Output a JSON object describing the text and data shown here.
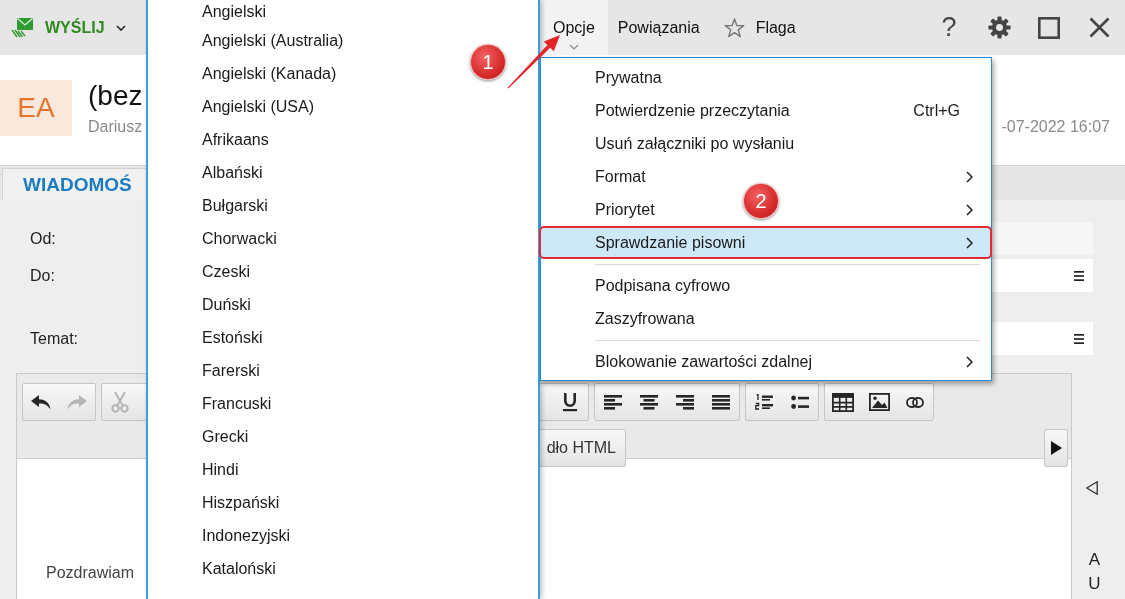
{
  "top_bar": {
    "send_button": {
      "label": "WYŚLIJ"
    },
    "tabs": [
      {
        "label": "Opcje",
        "kind": "menu",
        "expanded": true
      },
      {
        "label": "Powiązania",
        "kind": "menu",
        "expanded": false
      },
      {
        "label": "Flaga",
        "kind": "toggle",
        "expanded": false
      }
    ],
    "help_button": {
      "label": "?"
    }
  },
  "message": {
    "avatar_initials": "EA",
    "subject": "(bez",
    "sender": "Dariusz",
    "date": "-07-2022 16:07"
  },
  "message_tabs": [
    {
      "label": "WIADOMOŚ",
      "selected": true
    }
  ],
  "fields": [
    {
      "label": "Od:",
      "kind": "plain"
    },
    {
      "label": "Do:",
      "kind": "with_menu"
    },
    {
      "label": "Temat:",
      "kind": "with_menu"
    }
  ],
  "editor": {
    "toolbar": {
      "groups": [
        {
          "buttons": [
            {
              "kind": "undo",
              "disabled": false
            },
            {
              "kind": "redo",
              "disabled": true
            }
          ]
        },
        {
          "buttons": [
            {
              "kind": "cut",
              "disabled": true
            },
            {
              "kind": "underline",
              "disabled": false
            }
          ]
        },
        {
          "buttons": [
            {
              "kind": "align_left",
              "disabled": false
            },
            {
              "kind": "align_center",
              "disabled": false
            },
            {
              "kind": "align_right",
              "disabled": false
            },
            {
              "kind": "justify",
              "disabled": false
            }
          ]
        },
        {
          "buttons": [
            {
              "kind": "numbered_list",
              "disabled": false
            },
            {
              "kind": "bullet_list",
              "disabled": false
            }
          ]
        },
        {
          "buttons": [
            {
              "kind": "table",
              "disabled": false
            },
            {
              "kind": "image",
              "disabled": false
            },
            {
              "kind": "link",
              "disabled": false
            }
          ]
        }
      ]
    },
    "source_button": {
      "label": "dło HTML"
    },
    "body_lines": [
      "Pozdrawiam"
    ]
  },
  "side_panel": {
    "label": "AU"
  },
  "language_submenu": {
    "items": [
      {
        "label": "Angielski",
        "selected": false
      },
      {
        "label": "Angielski (Australia)",
        "selected": false
      },
      {
        "label": "Angielski (Kanada)",
        "selected": false
      },
      {
        "label": "Angielski (USA)",
        "selected": false
      },
      {
        "label": "Afrikaans",
        "selected": false
      },
      {
        "label": "Albański",
        "selected": false
      },
      {
        "label": "Bułgarski",
        "selected": false
      },
      {
        "label": "Chorwacki",
        "selected": false
      },
      {
        "label": "Czeski",
        "selected": false
      },
      {
        "label": "Duński",
        "selected": false
      },
      {
        "label": "Estoński",
        "selected": false
      },
      {
        "label": "Farerski",
        "selected": false
      },
      {
        "label": "Francuski",
        "selected": false
      },
      {
        "label": "Grecki",
        "selected": false
      },
      {
        "label": "Hindi",
        "selected": false
      },
      {
        "label": "Hiszpański",
        "selected": false
      },
      {
        "label": "Indonezyjski",
        "selected": false
      },
      {
        "label": "Kataloński",
        "selected": false
      }
    ]
  },
  "options_menu": {
    "sections": [
      {
        "items": [
          {
            "label": "Prywatna",
            "has_submenu": false,
            "selected": false,
            "outlined": false
          },
          {
            "label": "Potwierdzenie przeczytania",
            "shortcut": "Ctrl+G",
            "has_submenu": false,
            "selected": false,
            "outlined": false
          },
          {
            "label": "Usuń załączniki po wysłaniu",
            "has_submenu": false,
            "selected": false,
            "outlined": false
          },
          {
            "label": "Format",
            "has_submenu": true,
            "selected": false,
            "outlined": false
          },
          {
            "label": "Priorytet",
            "has_submenu": true,
            "selected": false,
            "outlined": false
          },
          {
            "label": "Sprawdzanie pisowni",
            "has_submenu": true,
            "selected": true,
            "outlined": true
          }
        ]
      },
      {
        "items": [
          {
            "label": "Podpisana cyfrowo",
            "has_submenu": false,
            "selected": false,
            "outlined": false
          },
          {
            "label": "Zaszyfrowana",
            "has_submenu": false,
            "selected": false,
            "outlined": false
          }
        ]
      },
      {
        "items": [
          {
            "label": "Blokowanie zawartości zdalnej",
            "has_submenu": true,
            "selected": false,
            "outlined": false
          }
        ]
      }
    ]
  },
  "callouts": [
    {
      "label": "1"
    },
    {
      "label": "2"
    }
  ]
}
